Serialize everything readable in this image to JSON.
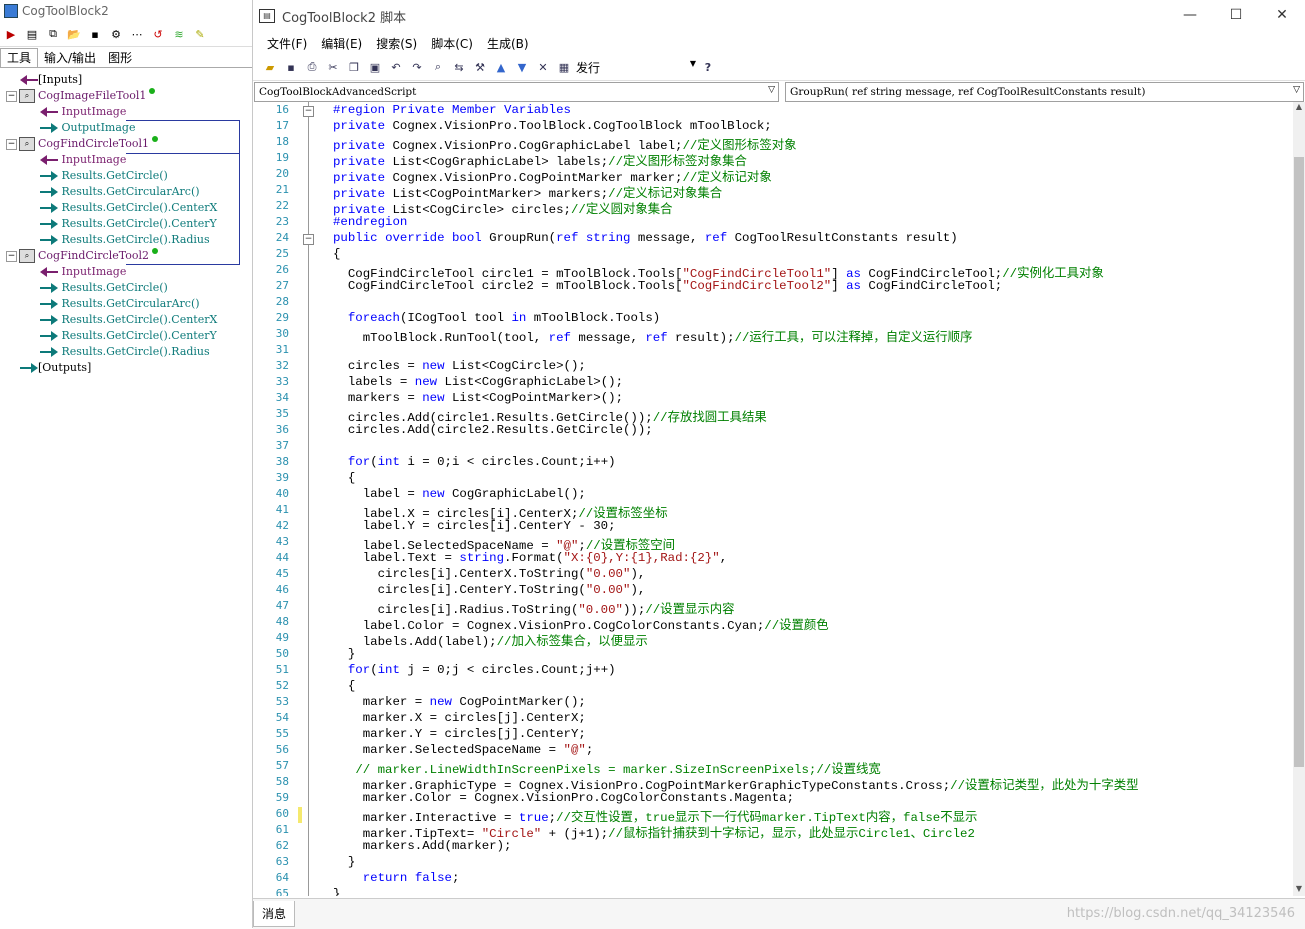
{
  "left": {
    "title": "CogToolBlock2",
    "tabs": [
      "工具",
      "输入/输出",
      "图形"
    ],
    "tree": [
      {
        "label": "[Inputs]",
        "kind": "plain"
      },
      {
        "label": "CogImageFileTool1",
        "kind": "tool"
      },
      {
        "label": "InputImage",
        "kind": "in"
      },
      {
        "label": "OutputImage",
        "kind": "out"
      },
      {
        "label": "CogFindCircleTool1",
        "kind": "tool"
      },
      {
        "label": "InputImage",
        "kind": "in"
      },
      {
        "label": "Results.GetCircle()",
        "kind": "out"
      },
      {
        "label": "Results.GetCircularArc()",
        "kind": "out"
      },
      {
        "label": "Results.GetCircle().CenterX",
        "kind": "out"
      },
      {
        "label": "Results.GetCircle().CenterY",
        "kind": "out"
      },
      {
        "label": "Results.GetCircle().Radius",
        "kind": "out"
      },
      {
        "label": "CogFindCircleTool2",
        "kind": "tool"
      },
      {
        "label": "InputImage",
        "kind": "in"
      },
      {
        "label": "Results.GetCircle()",
        "kind": "out"
      },
      {
        "label": "Results.GetCircularArc()",
        "kind": "out"
      },
      {
        "label": "Results.GetCircle().CenterX",
        "kind": "out"
      },
      {
        "label": "Results.GetCircle().CenterY",
        "kind": "out"
      },
      {
        "label": "Results.GetCircle().Radius",
        "kind": "out"
      },
      {
        "label": "[Outputs]",
        "kind": "plain"
      }
    ]
  },
  "window": {
    "title": "CogToolBlock2 脚本",
    "menus": [
      "文件(F)",
      "编辑(E)",
      "搜索(S)",
      "脚本(C)",
      "生成(B)"
    ],
    "build_config": "发行",
    "class_combo": "CogToolBlockAdvancedScript",
    "member_combo": "GroupRun( ref string message,  ref CogToolResultConstants result)",
    "bottom_tab": "消息",
    "watermark": "https://blog.csdn.net/qq_34123546"
  },
  "code_lines": [
    {
      "n": "16",
      "t": "#region Private Member Variables"
    },
    {
      "n": "17",
      "t": "private Cognex.VisionPro.ToolBlock.CogToolBlock mToolBlock;"
    },
    {
      "n": "18",
      "t": "private Cognex.VisionPro.CogGraphicLabel label;//定义图形标签对象"
    },
    {
      "n": "19",
      "t": "private List<CogGraphicLabel> labels;//定义图形标签对象集合"
    },
    {
      "n": "20",
      "t": "private Cognex.VisionPro.CogPointMarker marker;//定义标记对象"
    },
    {
      "n": "21",
      "t": "private List<CogPointMarker> markers;//定义标记对象集合"
    },
    {
      "n": "22",
      "t": "private List<CogCircle> circles;//定义圆对象集合"
    },
    {
      "n": "23",
      "t": "#endregion"
    },
    {
      "n": "24",
      "t": "public override bool GroupRun(ref string message, ref CogToolResultConstants result)"
    },
    {
      "n": "25",
      "t": "{"
    },
    {
      "n": "26",
      "t": "  CogFindCircleTool circle1 = mToolBlock.Tools[\"CogFindCircleTool1\"] as CogFindCircleTool;//实例化工具对象"
    },
    {
      "n": "27",
      "t": "  CogFindCircleTool circle2 = mToolBlock.Tools[\"CogFindCircleTool2\"] as CogFindCircleTool;"
    },
    {
      "n": "28",
      "t": ""
    },
    {
      "n": "29",
      "t": "  foreach(ICogTool tool in mToolBlock.Tools)"
    },
    {
      "n": "30",
      "t": "    mToolBlock.RunTool(tool, ref message, ref result);//运行工具，可以注释掉，自定义运行顺序"
    },
    {
      "n": "31",
      "t": ""
    },
    {
      "n": "32",
      "t": "  circles = new List<CogCircle>();"
    },
    {
      "n": "33",
      "t": "  labels = new List<CogGraphicLabel>();"
    },
    {
      "n": "34",
      "t": "  markers = new List<CogPointMarker>();"
    },
    {
      "n": "35",
      "t": "  circles.Add(circle1.Results.GetCircle());//存放找圆工具结果"
    },
    {
      "n": "36",
      "t": "  circles.Add(circle2.Results.GetCircle());"
    },
    {
      "n": "37",
      "t": ""
    },
    {
      "n": "38",
      "t": "  for(int i = 0;i < circles.Count;i++)"
    },
    {
      "n": "39",
      "t": "  {"
    },
    {
      "n": "40",
      "t": "    label = new CogGraphicLabel();"
    },
    {
      "n": "41",
      "t": "    label.X = circles[i].CenterX;//设置标签坐标"
    },
    {
      "n": "42",
      "t": "    label.Y = circles[i].CenterY - 30;"
    },
    {
      "n": "43",
      "t": "    label.SelectedSpaceName = \"@\";//设置标签空间"
    },
    {
      "n": "44",
      "t": "    label.Text = string.Format(\"X:{0},Y:{1},Rad:{2}\","
    },
    {
      "n": "45",
      "t": "      circles[i].CenterX.ToString(\"0.00\"),"
    },
    {
      "n": "46",
      "t": "      circles[i].CenterY.ToString(\"0.00\"),"
    },
    {
      "n": "47",
      "t": "      circles[i].Radius.ToString(\"0.00\"));//设置显示内容"
    },
    {
      "n": "48",
      "t": "    label.Color = Cognex.VisionPro.CogColorConstants.Cyan;//设置颜色"
    },
    {
      "n": "49",
      "t": "    labels.Add(label);//加入标签集合，以便显示"
    },
    {
      "n": "50",
      "t": "  }"
    },
    {
      "n": "51",
      "t": "  for(int j = 0;j < circles.Count;j++)"
    },
    {
      "n": "52",
      "t": "  {"
    },
    {
      "n": "53",
      "t": "    marker = new CogPointMarker();"
    },
    {
      "n": "54",
      "t": "    marker.X = circles[j].CenterX;"
    },
    {
      "n": "55",
      "t": "    marker.Y = circles[j].CenterY;"
    },
    {
      "n": "56",
      "t": "    marker.SelectedSpaceName = \"@\";"
    },
    {
      "n": "57",
      "t": "   // marker.LineWidthInScreenPixels = marker.SizeInScreenPixels;//设置线宽"
    },
    {
      "n": "58",
      "t": "    marker.GraphicType = Cognex.VisionPro.CogPointMarkerGraphicTypeConstants.Cross;//设置标记类型，此处为十字类型"
    },
    {
      "n": "59",
      "t": "    marker.Color = Cognex.VisionPro.CogColorConstants.Magenta;"
    },
    {
      "n": "60",
      "t": "    marker.Interactive = true;//交互性设置，true显示下一行代码marker.TipText内容，false不显示"
    },
    {
      "n": "61",
      "t": "    marker.TipText= \"Circle\" + (j+1);//鼠标指针捕获到十字标记，显示，此处显示Circle1、Circle2"
    },
    {
      "n": "62",
      "t": "    markers.Add(marker);"
    },
    {
      "n": "63",
      "t": "  }"
    },
    {
      "n": "64",
      "t": "    return false;"
    },
    {
      "n": "65",
      "t": "}"
    }
  ]
}
